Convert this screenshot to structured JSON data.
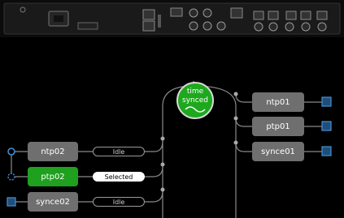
{
  "status": {
    "line1": "time",
    "line2": "synced"
  },
  "outputs": [
    {
      "label": "ntp01"
    },
    {
      "label": "ptp01"
    },
    {
      "label": "synce01"
    }
  ],
  "inputs": [
    {
      "label": "ntp02",
      "state": "Idle"
    },
    {
      "label": "ptp02",
      "state": "Selected"
    },
    {
      "label": "synce02",
      "state": "Idle"
    }
  ],
  "colors": {
    "active": "#1fa01f",
    "node": "#6f6f6f",
    "port": "#4a8fd0",
    "line": "#8a8a8a"
  }
}
